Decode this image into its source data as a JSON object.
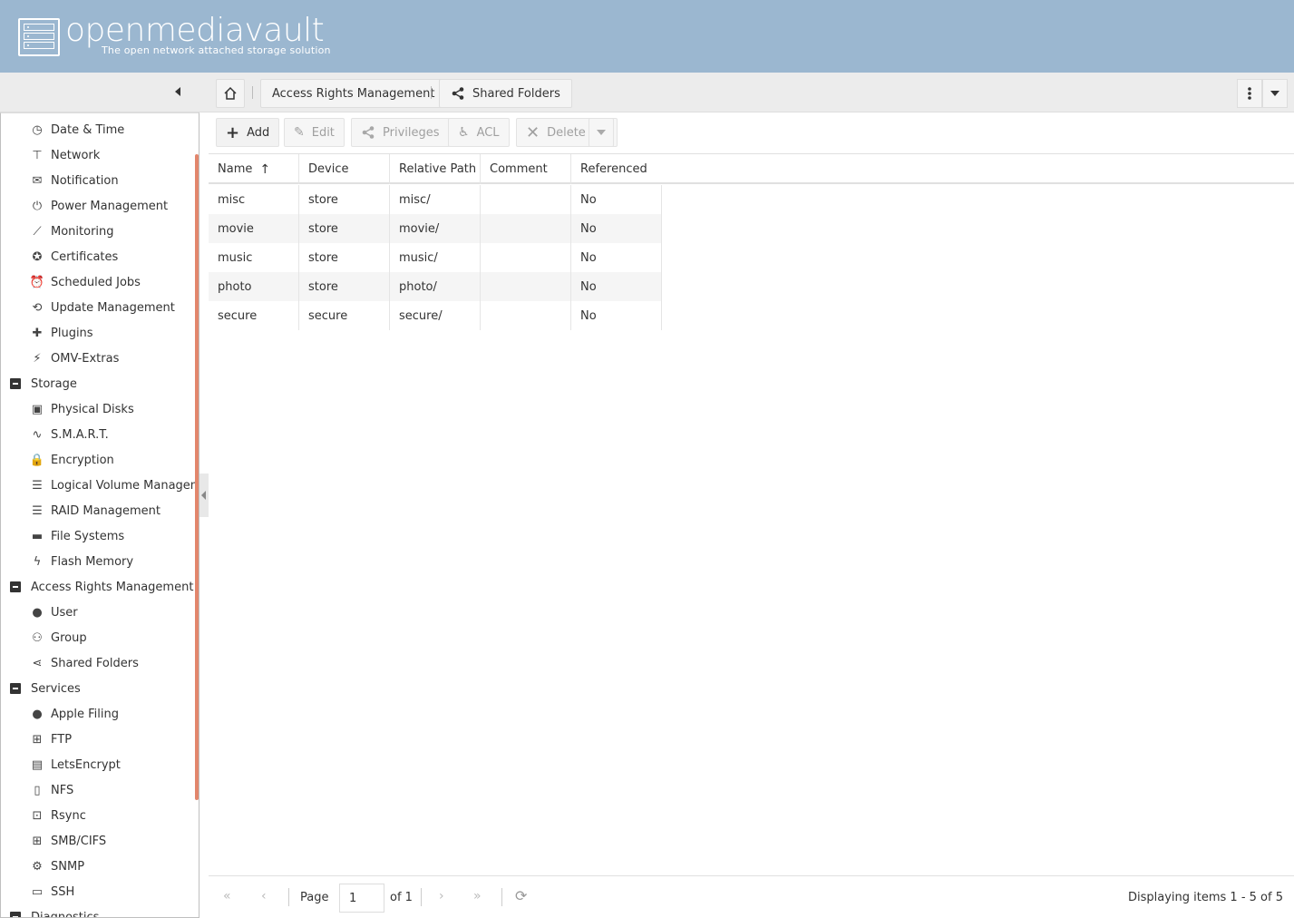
{
  "app": {
    "brand": "openmediavault",
    "tagline": "The open network attached storage solution"
  },
  "breadcrumb": {
    "section": "Access Rights Management",
    "page": "Shared Folders"
  },
  "sidebar": {
    "items": [
      {
        "label": "Date & Time",
        "icon": "clock-icon",
        "type": "item"
      },
      {
        "label": "Network",
        "icon": "network-icon",
        "type": "item"
      },
      {
        "label": "Notification",
        "icon": "envelope-icon",
        "type": "item"
      },
      {
        "label": "Power Management",
        "icon": "power-icon",
        "type": "item"
      },
      {
        "label": "Monitoring",
        "icon": "line-chart-icon",
        "type": "item"
      },
      {
        "label": "Certificates",
        "icon": "certificate-icon",
        "type": "item"
      },
      {
        "label": "Scheduled Jobs",
        "icon": "alarm-clock-icon",
        "type": "item"
      },
      {
        "label": "Update Management",
        "icon": "update-icon",
        "type": "item"
      },
      {
        "label": "Plugins",
        "icon": "puzzle-icon",
        "type": "item"
      },
      {
        "label": "OMV-Extras",
        "icon": "plug-icon",
        "type": "item"
      },
      {
        "label": "Storage",
        "icon": "collapse-icon",
        "type": "group"
      },
      {
        "label": "Physical Disks",
        "icon": "disk-icon",
        "type": "item"
      },
      {
        "label": "S.M.A.R.T.",
        "icon": "pulse-icon",
        "type": "item"
      },
      {
        "label": "Encryption",
        "icon": "lock-icon",
        "type": "item"
      },
      {
        "label": "Logical Volume Managem",
        "icon": "database-icon",
        "type": "item"
      },
      {
        "label": "RAID Management",
        "icon": "database-icon",
        "type": "item"
      },
      {
        "label": "File Systems",
        "icon": "folder-icon",
        "type": "item"
      },
      {
        "label": "Flash Memory",
        "icon": "flash-icon",
        "type": "item"
      },
      {
        "label": "Access Rights Management",
        "icon": "collapse-icon",
        "type": "group"
      },
      {
        "label": "User",
        "icon": "user-icon",
        "type": "item"
      },
      {
        "label": "Group",
        "icon": "users-icon",
        "type": "item"
      },
      {
        "label": "Shared Folders",
        "icon": "share-icon",
        "type": "item"
      },
      {
        "label": "Services",
        "icon": "collapse-icon",
        "type": "group"
      },
      {
        "label": "Apple Filing",
        "icon": "apple-icon",
        "type": "item"
      },
      {
        "label": "FTP",
        "icon": "ftp-icon",
        "type": "item"
      },
      {
        "label": "LetsEncrypt",
        "icon": "padlock-icon",
        "type": "item"
      },
      {
        "label": "NFS",
        "icon": "nfs-icon",
        "type": "item"
      },
      {
        "label": "Rsync",
        "icon": "rsync-icon",
        "type": "item"
      },
      {
        "label": "SMB/CIFS",
        "icon": "windows-icon",
        "type": "item"
      },
      {
        "label": "SNMP",
        "icon": "snmp-icon",
        "type": "item"
      },
      {
        "label": "SSH",
        "icon": "terminal-icon",
        "type": "item"
      },
      {
        "label": "Diagnostics",
        "icon": "collapse-icon",
        "type": "group"
      }
    ]
  },
  "toolbar": {
    "add": "Add",
    "edit": "Edit",
    "privileges": "Privileges",
    "acl": "ACL",
    "delete": "Delete"
  },
  "grid": {
    "columns": [
      "Name",
      "Device",
      "Relative Path",
      "Comment",
      "Referenced"
    ],
    "rows": [
      [
        "misc",
        "store",
        "misc/",
        "",
        "No"
      ],
      [
        "movie",
        "store",
        "movie/",
        "",
        "No"
      ],
      [
        "music",
        "store",
        "music/",
        "",
        "No"
      ],
      [
        "photo",
        "store",
        "photo/",
        "",
        "No"
      ],
      [
        "secure",
        "secure",
        "secure/",
        "",
        "No"
      ]
    ]
  },
  "pager": {
    "page_label": "Page",
    "page_value": "1",
    "of_label": "of 1",
    "status": "Displaying items 1 - 5 of 5"
  },
  "colors": {
    "header": "#9bb7d0",
    "accent": "#e2866c"
  }
}
